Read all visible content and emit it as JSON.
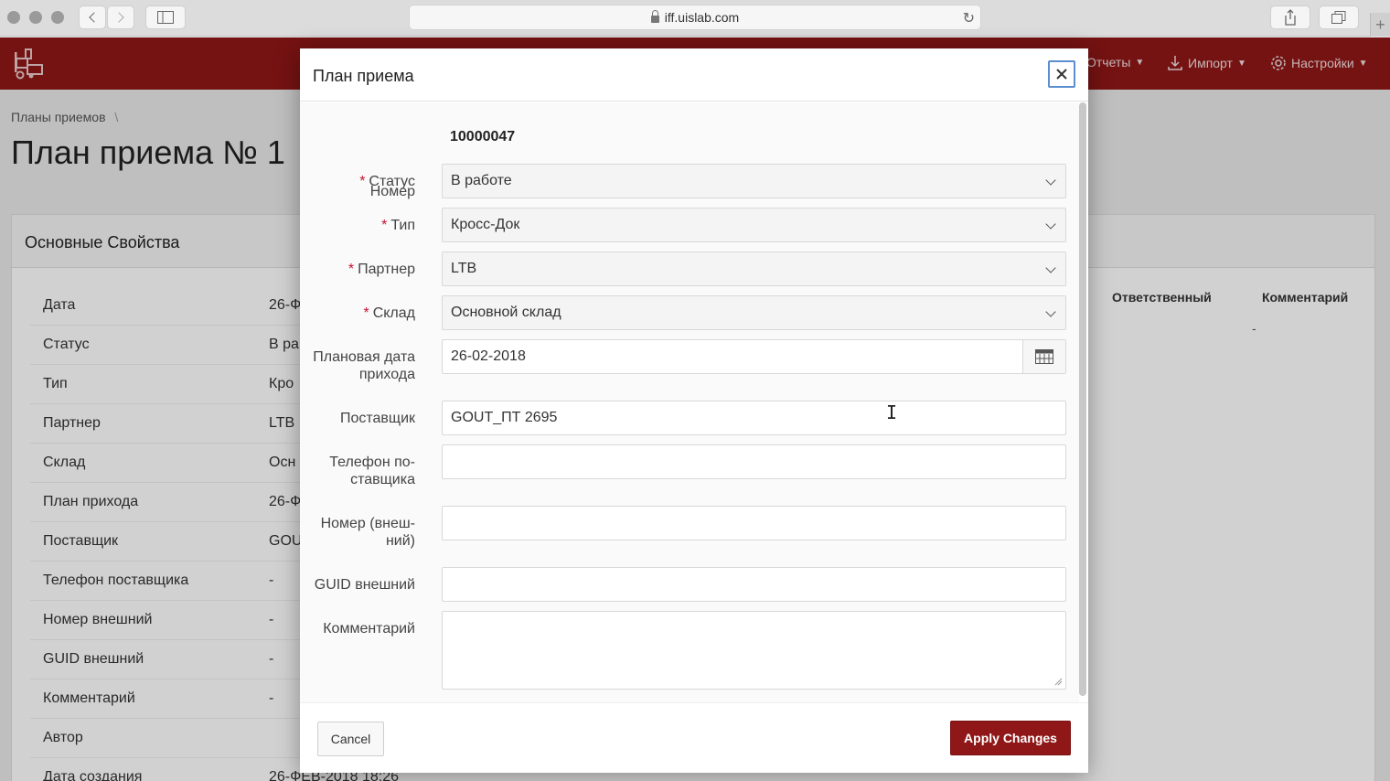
{
  "browser": {
    "url": "iff.uislab.com"
  },
  "appbar": {
    "nav": [
      {
        "label": "Отчеты",
        "icon": "caret-down-icon"
      },
      {
        "label": "Импорт",
        "icon": "download-icon"
      },
      {
        "label": "Настройки",
        "icon": "gear-icon"
      }
    ]
  },
  "page": {
    "breadcrumb": "Планы приемов",
    "breadcrumb_sep": "\\",
    "title": "План приема № 1",
    "section_title": "Основные Свойства",
    "properties": [
      {
        "key": "Дата",
        "value": "26-Ф"
      },
      {
        "key": "Статус",
        "value": "В ра"
      },
      {
        "key": "Тип",
        "value": "Кро"
      },
      {
        "key": "Партнер",
        "value": "LTB"
      },
      {
        "key": "Склад",
        "value": "Осн"
      },
      {
        "key": "План прихода",
        "value": "26-Ф"
      },
      {
        "key": "Поставщик",
        "value": "GOU"
      },
      {
        "key": "Телефон поставщика",
        "value": "-"
      },
      {
        "key": "Номер внешний",
        "value": "-"
      },
      {
        "key": "GUID внешний",
        "value": "-"
      },
      {
        "key": "Комментарий",
        "value": "-"
      },
      {
        "key": "Автор",
        "value": ""
      },
      {
        "key": "Дата создания",
        "value": "26-ФЕВ-2018 18:26"
      }
    ],
    "table_headers": [
      "Ответственный",
      "Комментарий"
    ],
    "table_cell": "-"
  },
  "modal": {
    "title": "План приема",
    "fields": {
      "number": {
        "label": "Номер",
        "value": "10000047"
      },
      "status": {
        "label": "Статус",
        "value": "В работе",
        "required": true
      },
      "type": {
        "label": "Тип",
        "value": "Кросс-Док",
        "required": true
      },
      "partner": {
        "label": "Партнер",
        "value": "LTB",
        "required": true
      },
      "warehouse": {
        "label": "Склад",
        "value": "Основной склад",
        "required": true
      },
      "planned_date": {
        "label_line1": "Плановая дата",
        "label_line2": "прихода",
        "value": "26-02-2018"
      },
      "supplier": {
        "label": "Поставщик",
        "value": "GOUT_ПТ 2695"
      },
      "supplier_phone": {
        "label_line1": "Телефон по-",
        "label_line2": "ставщика",
        "value": ""
      },
      "external_number": {
        "label_line1": "Номер (внеш-",
        "label_line2": "ний)",
        "value": ""
      },
      "external_guid": {
        "label": "GUID внешний",
        "value": ""
      },
      "comment": {
        "label": "Комментарий",
        "value": ""
      }
    },
    "cancel_label": "Cancel",
    "apply_label": "Apply Changes"
  },
  "colors": {
    "brand": "#8f1717",
    "required": "#c8102e",
    "focus": "#5b8fd1"
  }
}
